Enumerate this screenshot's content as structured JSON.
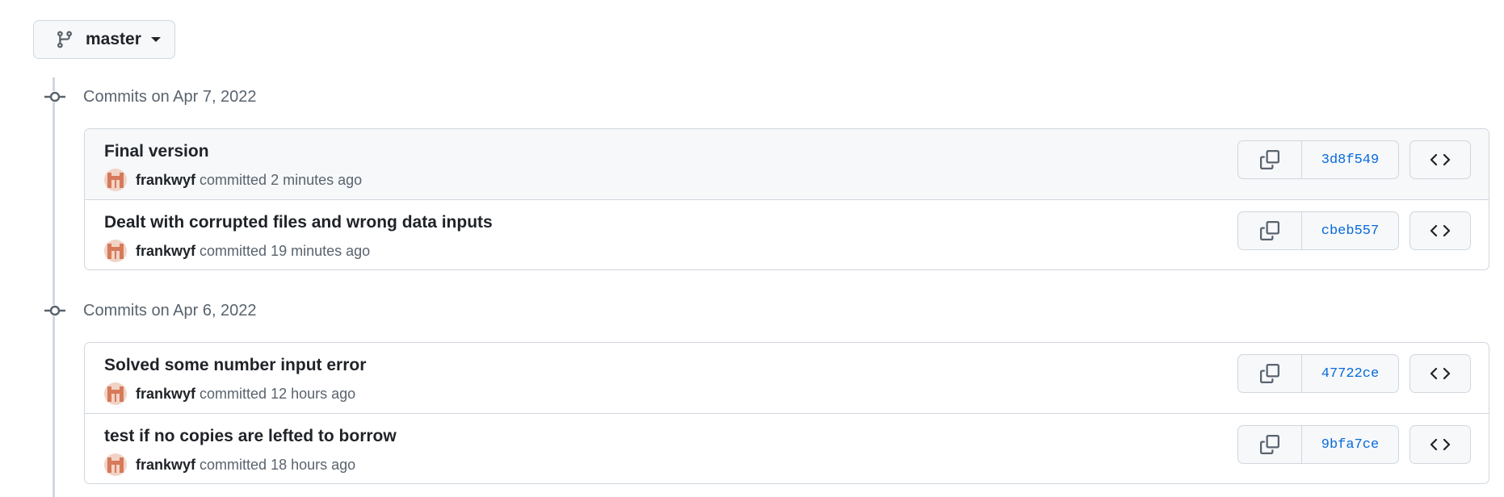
{
  "branch": {
    "name": "master",
    "icon": "git-branch-icon"
  },
  "colors": {
    "link": "#0969da",
    "muted": "#59636e",
    "border": "#d0d7de",
    "avatar": "#d67a5a"
  },
  "groups": [
    {
      "title": "Commits on Apr 7, 2022",
      "commits": [
        {
          "message": "Final version",
          "author": "frankwyf",
          "verb": "committed",
          "time": "2 minutes ago",
          "sha": "3d8f549"
        },
        {
          "message": "Dealt with corrupted files and wrong data inputs",
          "author": "frankwyf",
          "verb": "committed",
          "time": "19 minutes ago",
          "sha": "cbeb557"
        }
      ]
    },
    {
      "title": "Commits on Apr 6, 2022",
      "commits": [
        {
          "message": "Solved some number input error",
          "author": "frankwyf",
          "verb": "committed",
          "time": "12 hours ago",
          "sha": "47722ce"
        },
        {
          "message": "test if no copies are lefted to borrow",
          "author": "frankwyf",
          "verb": "committed",
          "time": "18 hours ago",
          "sha": "9bfa7ce"
        }
      ]
    }
  ]
}
